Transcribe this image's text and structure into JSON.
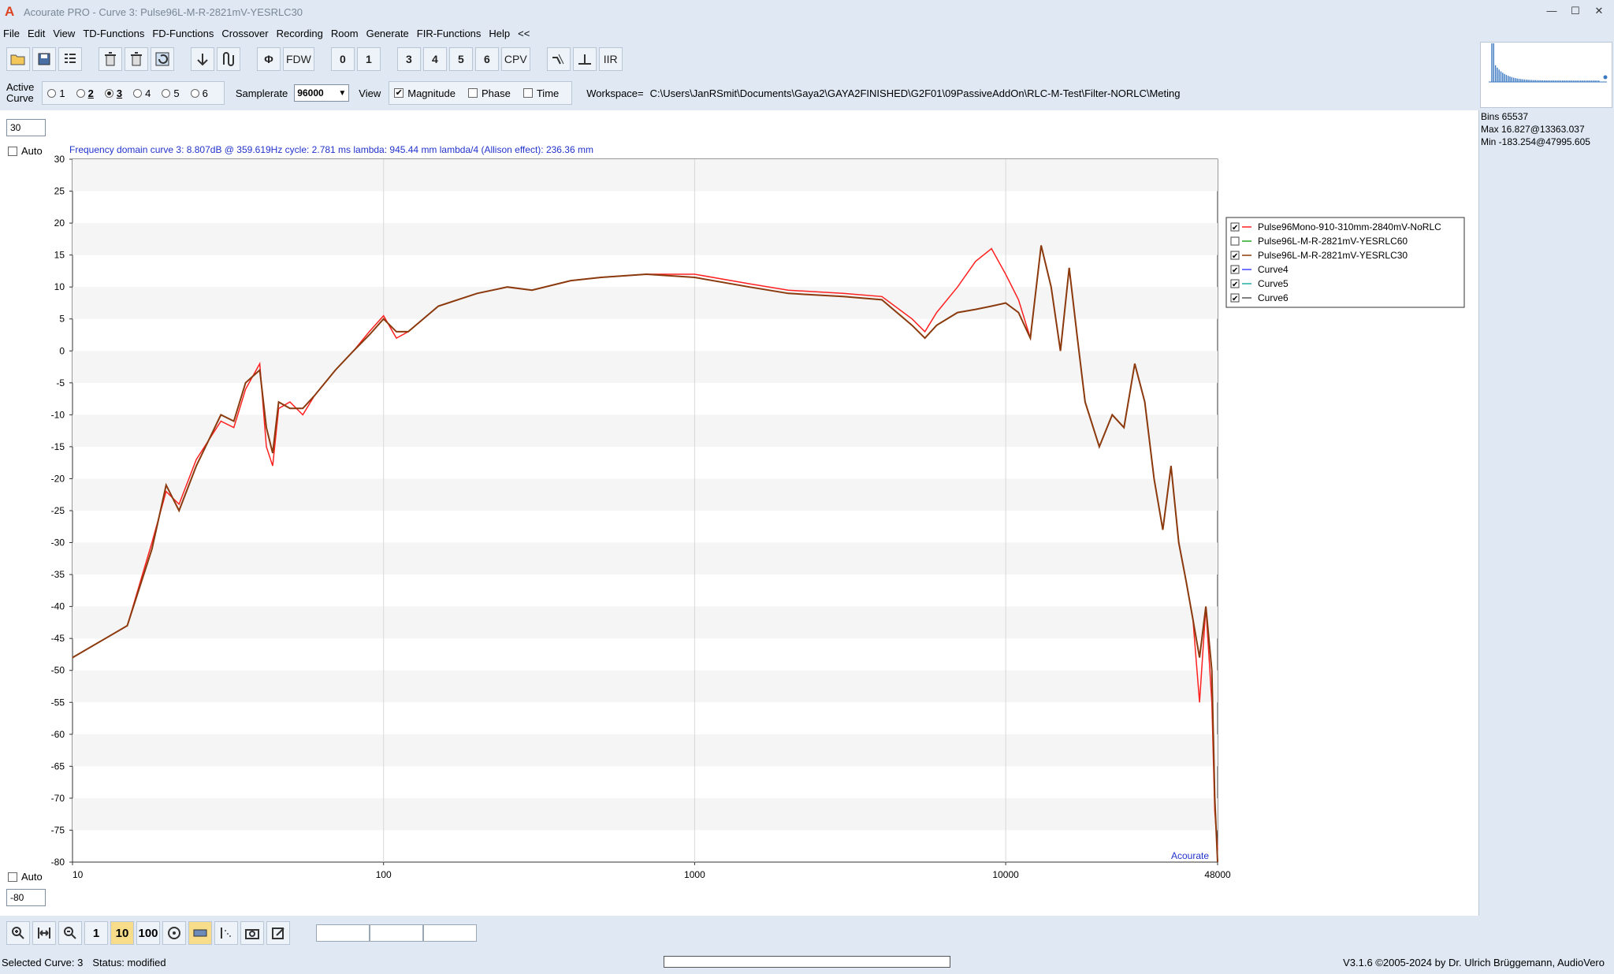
{
  "window": {
    "app_title": "Acourate PRO - Curve 3: Pulse96L-M-R-2821mV-YESRLC30",
    "logo_letter": "A",
    "buttons": [
      "—",
      "☐",
      "✕"
    ]
  },
  "menu": [
    "File",
    "Edit",
    "View",
    "TD-Functions",
    "FD-Functions",
    "Crossover",
    "Recording",
    "Room",
    "Generate",
    "FIR-Functions",
    "Help",
    "<<"
  ],
  "toolbar": {
    "phase_label": "Φ",
    "fdw_label": "FDW",
    "zero_label": "0",
    "one_label": "1",
    "curve_buttons": [
      "3",
      "4",
      "5",
      "6"
    ],
    "cpv_label": "CPV",
    "iir_label": "IIR"
  },
  "options": {
    "active_curve_label": "Active\nCurve",
    "active_curve_line1": "Active",
    "active_curve_line2": "Curve",
    "curve_radios": [
      "1",
      "2",
      "3",
      "4",
      "5",
      "6"
    ],
    "selected_curve": "3",
    "samplerate_label": "Samplerate",
    "samplerate_value": "96000",
    "view_label": "View",
    "view_magnitude": "Magnitude",
    "view_phase": "Phase",
    "view_time": "Time",
    "magnitude_checked": true,
    "workspace_label": "Workspace=",
    "workspace_path": "C:\\Users\\JanRSmit\\Documents\\Gaya2\\GAYA2FINISHED\\G2F01\\09PassiveAddOn\\RLC-M-Test\\Filter-NORLC\\Meting"
  },
  "side_panel": {
    "bins": "Bins 65537",
    "max": "Max 16.827@13363.037",
    "min": "Min -183.254@47995.605"
  },
  "plot": {
    "ymax_input": "30",
    "ymin_input": "-80",
    "auto_label": "Auto",
    "info": "Frequency domain curve 3:  8.807dB @ 359.619Hz    cycle: 2.781 ms    lambda: 945.44 mm    lambda/4 (Allison effect): 236.36 mm",
    "watermark": "Acourate"
  },
  "chart_data": {
    "type": "line",
    "title": "",
    "xlabel": "",
    "ylabel": "",
    "x_scale": "log",
    "xlim": [
      10,
      48000
    ],
    "ylim": [
      -80,
      30
    ],
    "x_ticks": [
      "10",
      "100",
      "1000",
      "10000",
      "48000"
    ],
    "y_ticks": [
      "30",
      "25",
      "20",
      "15",
      "10",
      "5",
      "0",
      "-5",
      "-10",
      "-15",
      "-20",
      "-25",
      "-30",
      "-35",
      "-40",
      "-45",
      "-50",
      "-55",
      "-60",
      "-65",
      "-70",
      "-75",
      "-80"
    ],
    "grid": true,
    "legend_position": "right",
    "legend": [
      {
        "name": "Pulse96Mono-910-310mm-2840mV-NoRLC",
        "checked": true,
        "color": "#ff2020"
      },
      {
        "name": "Pulse96L-M-R-2821mV-YESRLC60",
        "checked": false,
        "color": "#22aa22"
      },
      {
        "name": "Pulse96L-M-R-2821mV-YESRLC30",
        "checked": true,
        "color": "#8b3a0e"
      },
      {
        "name": "Curve4",
        "checked": true,
        "color": "#4444ff"
      },
      {
        "name": "Curve5",
        "checked": true,
        "color": "#22aaaa"
      },
      {
        "name": "Curve6",
        "checked": true,
        "color": "#555555"
      }
    ],
    "series": [
      {
        "name": "Pulse96Mono-910-310mm-2840mV-NoRLC",
        "color": "#ff2020",
        "x": [
          10,
          15,
          18,
          20,
          22,
          25,
          30,
          33,
          36,
          40,
          42,
          44,
          46,
          50,
          55,
          60,
          70,
          80,
          90,
          100,
          110,
          120,
          150,
          200,
          250,
          300,
          400,
          500,
          700,
          1000,
          1500,
          2000,
          3000,
          4000,
          5000,
          5500,
          6000,
          7000,
          8000,
          9000,
          10000,
          11000,
          12000,
          13000,
          14000,
          15000,
          16000,
          17000,
          18000,
          20000,
          22000,
          24000,
          26000,
          28000,
          30000,
          32000,
          34000,
          36000,
          38000,
          40000,
          42000,
          44000,
          46000,
          47000,
          48000
        ],
        "y": [
          -48,
          -43,
          -30,
          -22,
          -24,
          -17,
          -11,
          -12,
          -6,
          -2,
          -15,
          -18,
          -9,
          -8,
          -10,
          -7,
          -3,
          0,
          3,
          5.5,
          2,
          3,
          7,
          9,
          10,
          9.5,
          11,
          11.5,
          12,
          12,
          10.5,
          9.5,
          9,
          8.5,
          5,
          3,
          6,
          10,
          14,
          16,
          12,
          8,
          2,
          16.5,
          10,
          0,
          13,
          2,
          -8,
          -15,
          -10,
          -12,
          -2,
          -8,
          -20,
          -28,
          -18,
          -30,
          -36,
          -42,
          -55,
          -40,
          -55,
          -72,
          -78
        ]
      },
      {
        "name": "Pulse96L-M-R-2821mV-YESRLC30",
        "color": "#8b3a0e",
        "x": [
          10,
          15,
          18,
          20,
          22,
          25,
          30,
          33,
          36,
          40,
          42,
          44,
          46,
          50,
          55,
          60,
          70,
          80,
          90,
          100,
          110,
          120,
          150,
          200,
          250,
          300,
          400,
          500,
          700,
          1000,
          1500,
          2000,
          3000,
          4000,
          5000,
          5500,
          6000,
          7000,
          8000,
          9000,
          10000,
          11000,
          12000,
          13000,
          14000,
          15000,
          16000,
          17000,
          18000,
          20000,
          22000,
          24000,
          26000,
          28000,
          30000,
          32000,
          34000,
          36000,
          38000,
          40000,
          42000,
          44000,
          46000,
          47000,
          48000
        ],
        "y": [
          -48,
          -43,
          -31,
          -21,
          -25,
          -18,
          -10,
          -11,
          -5,
          -3,
          -12,
          -16,
          -8,
          -9,
          -9,
          -7,
          -3,
          0,
          2.5,
          5,
          3,
          3,
          7,
          9,
          10,
          9.5,
          11,
          11.5,
          12,
          11.5,
          10,
          9,
          8.5,
          8,
          4,
          2,
          4,
          6,
          6.5,
          7,
          7.5,
          6,
          2,
          16.5,
          10,
          0,
          13,
          2,
          -8,
          -15,
          -10,
          -12,
          -2,
          -8,
          -20,
          -28,
          -18,
          -30,
          -36,
          -42,
          -48,
          -40,
          -50,
          -70,
          -80
        ]
      }
    ]
  },
  "bottom_toolbar": {
    "zoom_1": "1",
    "zoom_10": "10",
    "zoom_100": "100"
  },
  "status": {
    "selected_curve": "Selected Curve: 3",
    "status_text": "Status: modified",
    "copyright": "V3.1.6 ©2005-2024 by Dr. Ulrich Brüggemann, AudioVero"
  }
}
